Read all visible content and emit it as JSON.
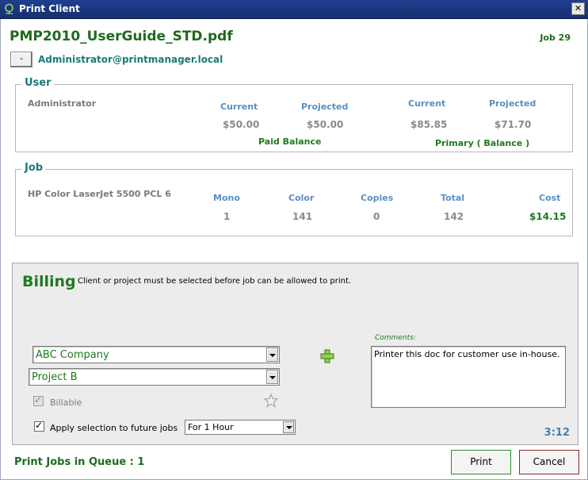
{
  "window": {
    "title": "Print Client",
    "close_glyph": "✕"
  },
  "header": {
    "filename": "PMP2010_UserGuide_STD.pdf",
    "job_number": "Job 29",
    "collapse_glyph": "-",
    "email": "Administrator@printmanager.local"
  },
  "user_group": {
    "legend": "User",
    "name": "Administrator",
    "paid": {
      "current_label": "Current",
      "projected_label": "Projected",
      "current_value": "$50.00",
      "projected_value": "$50.00",
      "caption": "Paid Balance"
    },
    "primary": {
      "current_label": "Current",
      "projected_label": "Projected",
      "current_value": "$85.85",
      "projected_value": "$71.70",
      "caption": "Primary ( Balance )"
    }
  },
  "job_group": {
    "legend": "Job",
    "printer": "HP Color LaserJet 5500 PCL 6",
    "headers": [
      "Mono",
      "Color",
      "Copies",
      "Total",
      "Cost"
    ],
    "values": [
      "1",
      "141",
      "0",
      "142",
      "$14.15"
    ]
  },
  "billing": {
    "title": "Billing",
    "message": "Client or project must be selected before job can be allowed to print.",
    "client_value": "ABC Company",
    "project_value": "Project B",
    "billable_label": "Billable",
    "billable_checked": true,
    "apply_label": "Apply selection to future jobs",
    "apply_checked": true,
    "duration_value": "For 1 Hour",
    "comments_label": "Comments:",
    "comments_value": "Printer this doc for customer use in-house.",
    "timer": "3:12",
    "check_glyph": "✓"
  },
  "footer": {
    "queue": "Print Jobs in Queue : 1",
    "print_label": "Print",
    "cancel_label": "Cancel"
  },
  "colors": {
    "green": "#1f7a1f",
    "teal": "#1b7a7a",
    "blue": "#5a8ec2",
    "titlebar": "#1f3f8f"
  }
}
